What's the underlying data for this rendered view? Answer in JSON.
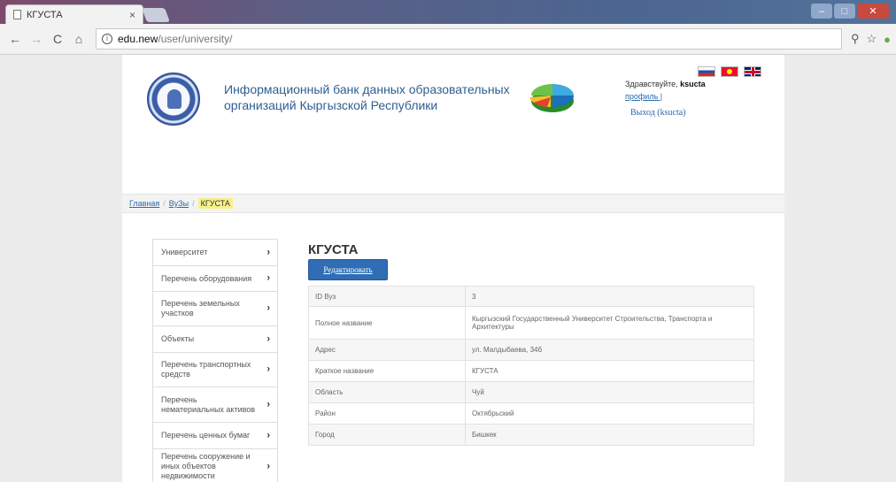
{
  "browser": {
    "tab_title": "КГУСТА",
    "tab_close": "×",
    "url_host": "edu.new",
    "url_path": "/user/university/",
    "info_glyph": "i",
    "back_glyph": "←",
    "forward_glyph": "→",
    "reload_glyph": "C",
    "home_glyph": "⌂",
    "pin_glyph": "⚲",
    "star_glyph": "☆",
    "ext_glyph": "●",
    "min_glyph": "–",
    "max_glyph": "□",
    "close_glyph": "✕"
  },
  "header": {
    "site_title": "Информационный банк данных образовательных организаций Кыргызской Республики",
    "greeting_prefix": "Здравствуйте,",
    "username": "ksucta",
    "profile_link": "профиль |",
    "logout_link": "Выход (ksucta)"
  },
  "breadcrumb": {
    "home": "Главная",
    "universities": "ВуЗы",
    "current": "КГУСТА",
    "sep": "/"
  },
  "sidebar": {
    "chevron": "›",
    "items": [
      "Университет",
      "Перечень оборудования",
      "Перечень земельных участков",
      "Объекты",
      "Перечень транспортных средств",
      "Перечень нематериальных активов",
      "Перечень ценных бумаг",
      "Перечень сооружение и иных объектов недвижимости"
    ]
  },
  "main": {
    "title": "КГУСТА",
    "edit_button": "Редактировать",
    "rows": [
      {
        "key": "ID Вуз",
        "value": "3"
      },
      {
        "key": "Полное название",
        "value": "Кыргызский Государственный Университет Строительства, Транспорта и Архитектуры"
      },
      {
        "key": "Адрес",
        "value": "ул. Малдыбаева, 34б"
      },
      {
        "key": "Краткое название",
        "value": "КГУСТА"
      },
      {
        "key": "Область",
        "value": "Чуй"
      },
      {
        "key": "Район",
        "value": "Октябрьский"
      },
      {
        "key": "Город",
        "value": "Бишкек"
      }
    ]
  },
  "colors": {
    "accent": "#2f6db4",
    "link": "#2b6aad",
    "title": "#2e5e92",
    "highlight": "#f6f08a"
  }
}
